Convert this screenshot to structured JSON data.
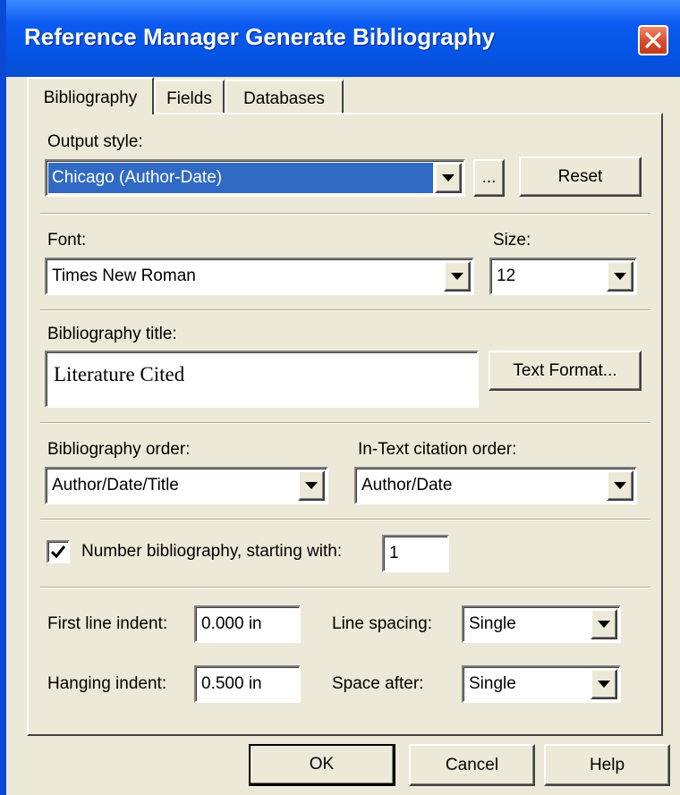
{
  "window": {
    "title": "Reference Manager Generate Bibliography"
  },
  "tabs": [
    {
      "label": "Bibliography",
      "active": true
    },
    {
      "label": "Fields",
      "active": false
    },
    {
      "label": "Databases",
      "active": false
    }
  ],
  "output_style": {
    "label": "Output style:",
    "value": "Chicago (Author-Date)",
    "browse_label": "...",
    "reset_label": "Reset"
  },
  "font": {
    "label": "Font:",
    "value": "Times New Roman"
  },
  "size": {
    "label": "Size:",
    "value": "12"
  },
  "bib_title": {
    "label": "Bibliography title:",
    "value": "Literature Cited",
    "text_format_label": "Text Format..."
  },
  "bib_order": {
    "label": "Bibliography order:",
    "value": "Author/Date/Title"
  },
  "intext_order": {
    "label": "In-Text citation order:",
    "value": "Author/Date"
  },
  "number_bib": {
    "label": "Number bibliography, starting with:",
    "checked": true,
    "value": "1"
  },
  "first_line_indent": {
    "label": "First line indent:",
    "value": "0.000 in"
  },
  "hanging_indent": {
    "label": "Hanging indent:",
    "value": "0.500 in"
  },
  "line_spacing": {
    "label": "Line spacing:",
    "value": "Single"
  },
  "space_after": {
    "label": "Space after:",
    "value": "Single"
  },
  "buttons": {
    "ok": "OK",
    "cancel": "Cancel",
    "help": "Help"
  },
  "colors": {
    "titlebar": "#0454e5",
    "dialog_bg": "#ece9d8",
    "selection": "#316ac5",
    "close": "#d8502e"
  },
  "icons": {
    "close": "close-icon",
    "dropdown": "chevron-down-icon",
    "check": "checkmark-icon"
  }
}
